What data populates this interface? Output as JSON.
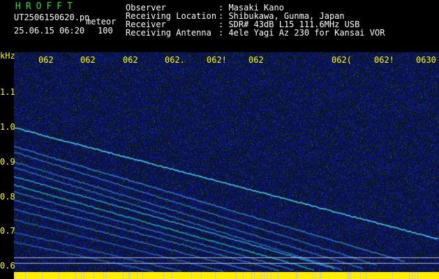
{
  "header": {
    "program": "HROFFT",
    "filename": "UT2506150620.pn",
    "mode": "meteor",
    "datetime": "25.06.15 06:20",
    "level": "100",
    "fields": [
      {
        "label": "Observer",
        "value": ": Masaki Kano"
      },
      {
        "label": "Receiving Location",
        "value": ": Shibukawa, Gunma, Japan"
      },
      {
        "label": "Receiver",
        "value": ": SDR# 43dB L15 111.6MHz USB"
      },
      {
        "label": "Receiving Antenna",
        "value": ": 4ele Yagi Az 230 for Kansai VOR"
      }
    ]
  },
  "time_ticks": [
    "062",
    "062",
    "062",
    "062.",
    "062!",
    "062",
    "062(",
    "062!",
    "0630"
  ],
  "freq_axis": {
    "unit": "kHz",
    "labels": [
      "1.1",
      "1.0",
      "0.9",
      "0.8",
      "0.7",
      "0.6"
    ],
    "values": [
      1.1,
      1.0,
      0.9,
      0.8,
      0.7,
      0.6
    ]
  },
  "colors": {
    "background": "#000000",
    "noise": "#1020a0",
    "trace": "#00ffd0",
    "bottom_bar": "#ffee00",
    "text": "#ffffff",
    "axis": "#ffff00",
    "title": "#22dd22"
  }
}
